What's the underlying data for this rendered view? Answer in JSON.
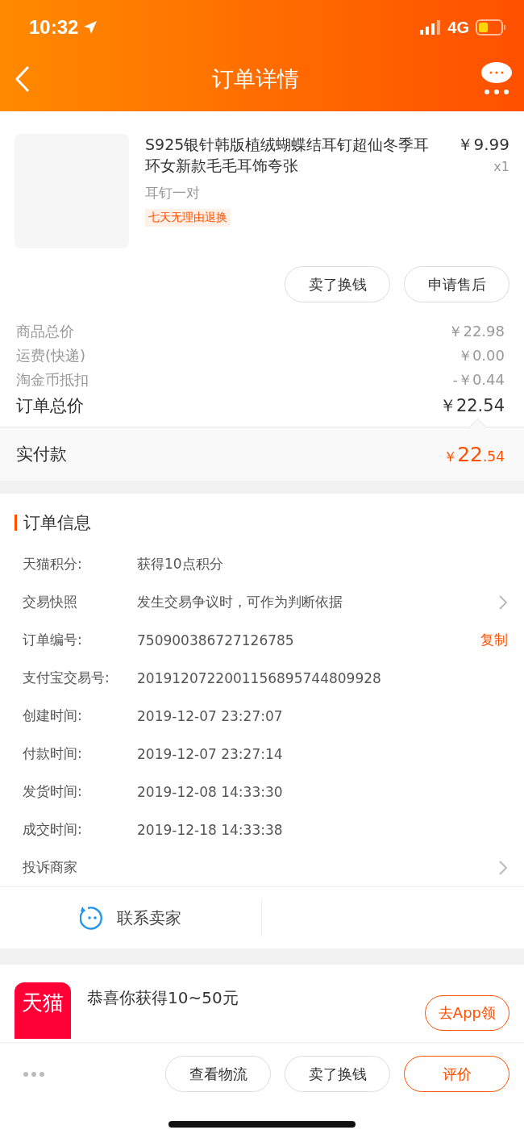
{
  "status_bar": {
    "time": "10:32",
    "network": "4G"
  },
  "header": {
    "title": "订单详情"
  },
  "product": {
    "title": "S925银针韩版植绒蝴蝶结耳钉超仙冬季耳环女新款毛毛耳饰夸张",
    "variant": "耳钉一对",
    "tag": "七天无理由退换",
    "price": "￥9.99",
    "quantity": "x1",
    "buttons": [
      "卖了换钱",
      "申请售后"
    ]
  },
  "price_rows": [
    {
      "label": "商品总价",
      "value": "￥22.98",
      "kind": "minor"
    },
    {
      "label": "运费(快递)",
      "value": "￥0.00",
      "kind": "minor"
    },
    {
      "label": "淘金币抵扣",
      "value": "-￥0.44",
      "kind": "minor"
    },
    {
      "label": "订单总价",
      "value": "￥22.54",
      "kind": "total"
    }
  ],
  "paid": {
    "label": "实付款",
    "currency": "￥",
    "integer": "22",
    "decimal": ".54"
  },
  "order_info": {
    "title": "订单信息",
    "rows": [
      {
        "label": "天猫积分:",
        "value": "获得10点积分",
        "kind": "plain"
      },
      {
        "label": "交易快照",
        "value": "发生交易争议时，可作为判断依据",
        "kind": "chevron"
      },
      {
        "label": "订单编号:",
        "value": "750900386727126785",
        "kind": "copy",
        "action": "复制"
      },
      {
        "label": "支付宝交易号:",
        "value": "2019120722001156895744809928",
        "kind": "plain"
      },
      {
        "label": "创建时间:",
        "value": "2019-12-07 23:27:07",
        "kind": "plain"
      },
      {
        "label": "付款时间:",
        "value": "2019-12-07 23:27:14",
        "kind": "plain"
      },
      {
        "label": "发货时间:",
        "value": "2019-12-08 14:33:30",
        "kind": "plain"
      },
      {
        "label": "成交时间:",
        "value": "2019-12-18 14:33:38",
        "kind": "plain"
      },
      {
        "label": "投诉商家",
        "kind": "chevron"
      }
    ]
  },
  "contact": {
    "label": "联系卖家"
  },
  "promo": {
    "logo": "天猫",
    "title": "恭喜你获得10~50元",
    "button": "去App领"
  },
  "bottom_bar": {
    "buttons": [
      {
        "label": "查看物流",
        "primary": false
      },
      {
        "label": "卖了换钱",
        "primary": false
      },
      {
        "label": "评价",
        "primary": true
      }
    ]
  }
}
